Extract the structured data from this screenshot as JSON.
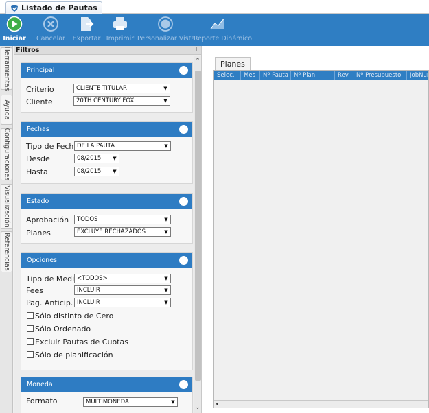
{
  "document_tab": {
    "title": "Listado de Pautas"
  },
  "toolbar": {
    "buttons": [
      {
        "label": "Iniciar",
        "icon": "play-icon"
      },
      {
        "label": "Cancelar",
        "icon": "cancel-icon"
      },
      {
        "label": "Exportar",
        "icon": "export-icon"
      },
      {
        "label": "Imprimir",
        "icon": "printer-icon"
      },
      {
        "label": "Personalizar Vista",
        "icon": "globe-icon"
      },
      {
        "label": "Reporte Dinámico",
        "icon": "chart-icon"
      }
    ],
    "accent": "#2f7ec3"
  },
  "side_tabs": [
    "Herramientas",
    "Ayuda",
    "Configuraciones",
    "Visualización",
    "Referencias"
  ],
  "filters": {
    "title": "Filtros",
    "pin": "⊥",
    "principal": {
      "title": "Principal",
      "criterio_label": "Criterio",
      "criterio_value": "CLIENTE TITULAR",
      "cliente_label": "Cliente",
      "cliente_value": "20TH CENTURY FOX"
    },
    "fechas": {
      "title": "Fechas",
      "tipo_label": "Tipo de Fecha",
      "tipo_value": "DE LA PAUTA",
      "desde_label": "Desde",
      "desde_value": "08/2015",
      "hasta_label": "Hasta",
      "hasta_value": "08/2015"
    },
    "estado": {
      "title": "Estado",
      "aprobacion_label": "Aprobación",
      "aprobacion_value": "TODOS",
      "planes_label": "Planes",
      "planes_value": "EXCLUYE RECHAZADOS"
    },
    "opciones": {
      "title": "Opciones",
      "tipo_medio_label": "Tipo de Medio",
      "tipo_medio_value": "<TODOS>",
      "fees_label": "Fees",
      "fees_value": "INCLUIR",
      "pag_label": "Pag. Anticip.",
      "pag_value": "INCLUIR",
      "checks": [
        "Sólo distinto de Cero",
        "Sólo Ordenado",
        "Excluir Pautas de Cuotas",
        "Sólo de planificación"
      ]
    },
    "moneda": {
      "title": "Moneda",
      "formato_label": "Formato",
      "formato_value": "MULTIMONEDA"
    }
  },
  "main": {
    "tab_label": "Planes",
    "columns": [
      "Selec.",
      "Mes",
      "Nº Pauta",
      "Nº Plan",
      "Rev",
      "Nº Presupuesto",
      "JobNum"
    ]
  }
}
